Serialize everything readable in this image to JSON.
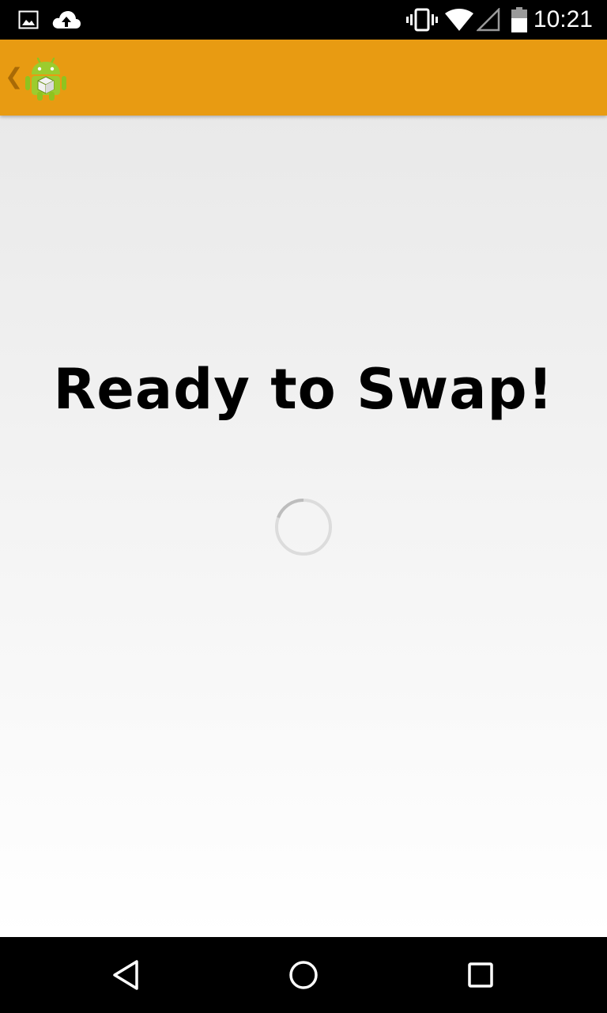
{
  "status_bar": {
    "time": "10:21",
    "icons": [
      "image-icon",
      "cloud-upload-icon",
      "vibrate-icon",
      "wifi-icon",
      "cell-signal-icon",
      "battery-icon"
    ]
  },
  "action_bar": {
    "background_color": "#e89b12",
    "up_icon": "chevron-left-icon",
    "app_icon": "android-app-icon"
  },
  "main": {
    "title": "Ready to Swap!",
    "loading": true
  },
  "nav_bar": {
    "buttons": [
      "back-icon",
      "home-icon",
      "recents-icon"
    ]
  }
}
